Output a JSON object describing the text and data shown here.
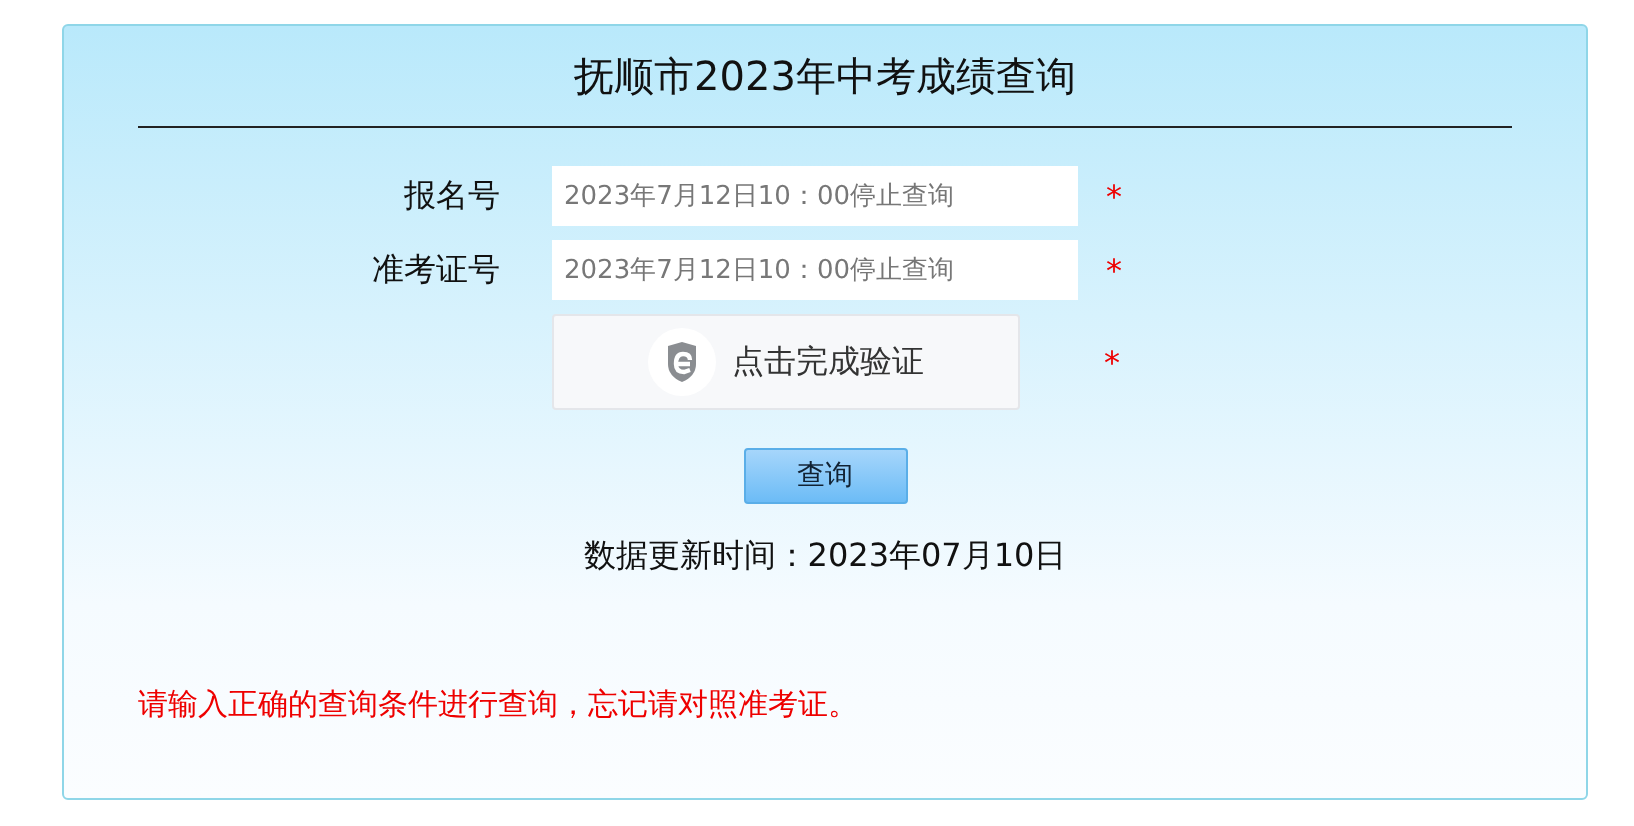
{
  "title": "抚顺市2023年中考成绩查询",
  "fields": [
    {
      "label": "报名号",
      "placeholder": "2023年7月12日10：00停止查询",
      "required_mark": "*"
    },
    {
      "label": "准考证号",
      "placeholder": "2023年7月12日10：00停止查询",
      "required_mark": "*"
    }
  ],
  "captcha": {
    "label": "点击完成验证",
    "required_mark": "*"
  },
  "query_button": "查询",
  "update_time": "数据更新时间：2023年07月10日",
  "notice": "请输入正确的查询条件进行查询，忘记请对照准考证。"
}
